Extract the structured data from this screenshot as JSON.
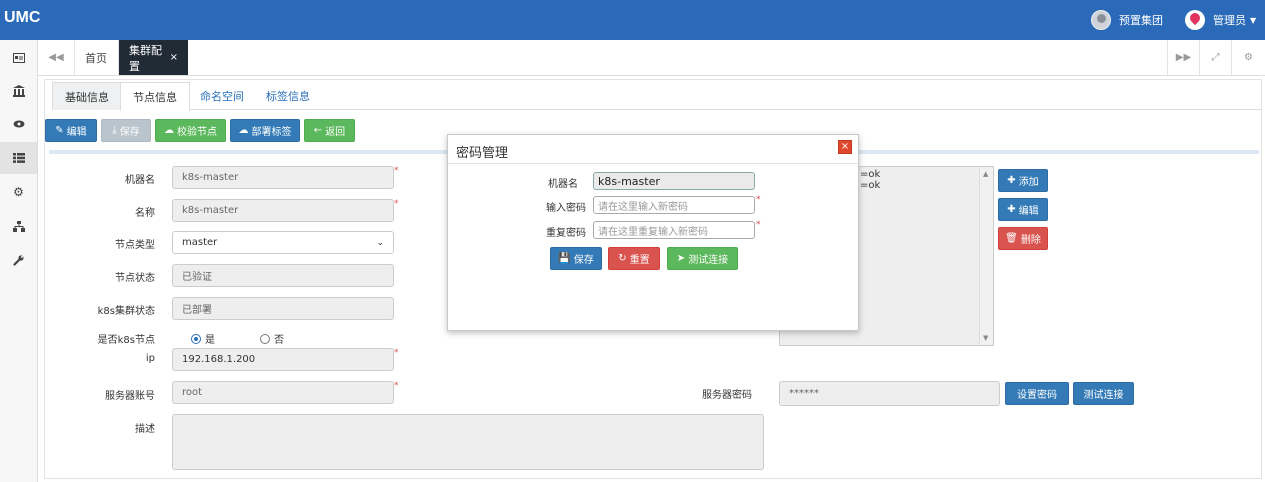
{
  "app": {
    "logo": "UMC"
  },
  "topbar": {
    "org_name": "预置集团",
    "user_name": "管理员"
  },
  "tabs": {
    "home": "首页",
    "current": "集群配置",
    "close": "×"
  },
  "subtabs": [
    "基础信息",
    "节点信息",
    "命名空间",
    "标签信息"
  ],
  "toolbar": {
    "edit": "编辑",
    "save": "保存",
    "verify_node": "校验节点",
    "deploy_label": "部署标签",
    "back": "返回"
  },
  "form": {
    "hostname_label": "机器名",
    "hostname_value": "k8s-master",
    "name_label": "名称",
    "name_value": "k8s-master",
    "node_type_label": "节点类型",
    "node_type_value": "master",
    "node_status_label": "节点状态",
    "node_status_value": "已验证",
    "k8s_status_label": "k8s集群状态",
    "k8s_status_value": "已部署",
    "is_k8s_label": "是否k8s节点",
    "is_k8s_yes": "是",
    "is_k8s_no": "否",
    "is_k8s_selected": "是",
    "ip_label": "ip",
    "ip_value": "192.168.1.200",
    "account_label": "服务器账号",
    "account_value": "root",
    "desc_label": "描述",
    "desc_value": "",
    "password_label": "服务器密码",
    "password_value": "******",
    "set_password": "设置密码",
    "test_connection": "测试连接",
    "required_mark": "*"
  },
  "labels_box": {
    "lines": [
      "=ok",
      "=ok"
    ],
    "add": "添加",
    "edit": "编辑",
    "delete": "删除"
  },
  "modal": {
    "title": "密码管理",
    "close": "×",
    "hostname_label": "机器名",
    "hostname_value": "k8s-master",
    "password_label": "输入密码",
    "password_placeholder": "请在这里输入新密码",
    "repeat_label": "重复密码",
    "repeat_placeholder": "请在这里重复输入新密码",
    "save": "保存",
    "reset": "重置",
    "test": "测试连接",
    "required_mark": "*"
  },
  "colors": {
    "topbar": "#2b6ab8",
    "primary": "#337ab7",
    "success": "#5cb85c",
    "danger": "#d9534f",
    "active_tab": "#212b36"
  }
}
